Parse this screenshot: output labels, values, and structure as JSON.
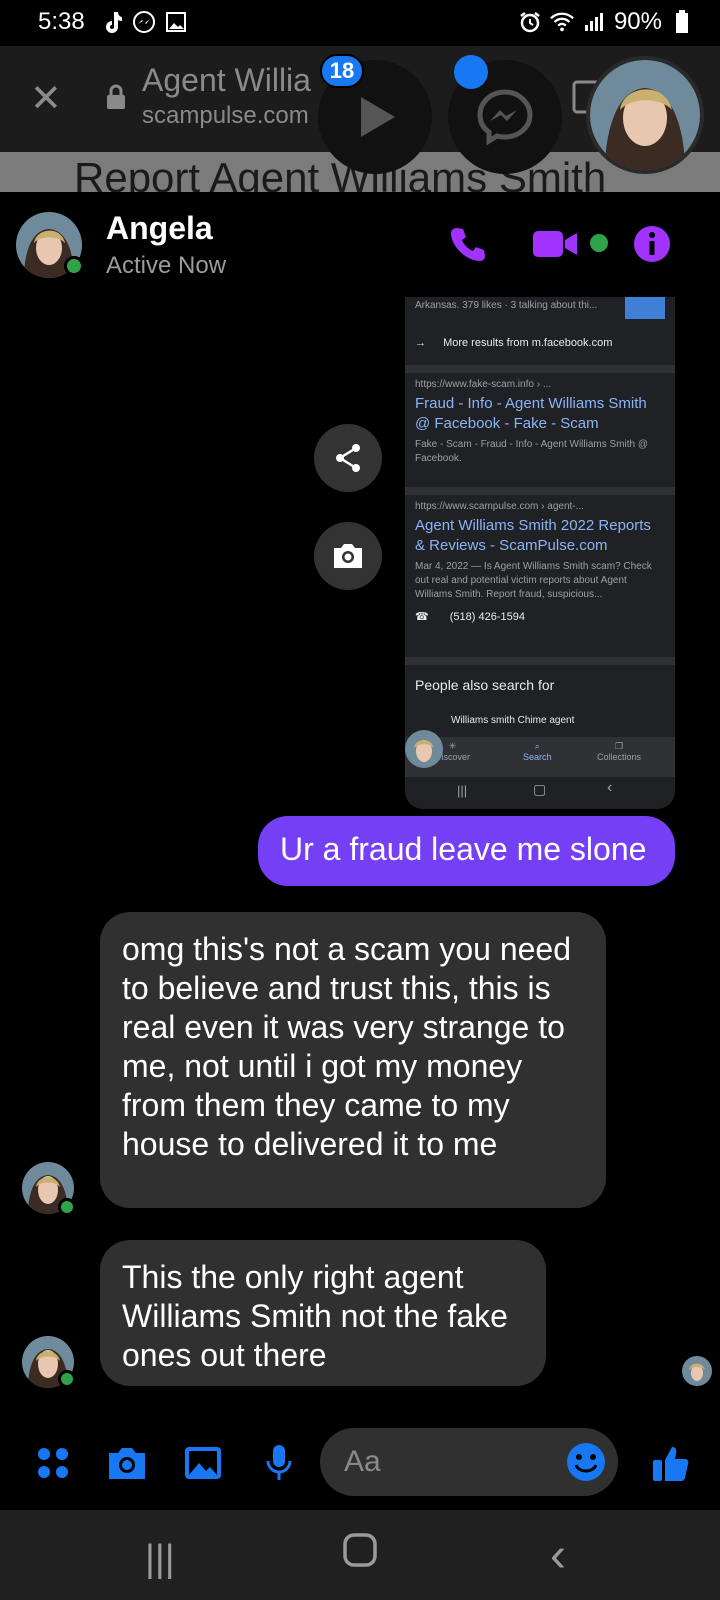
{
  "status_bar": {
    "time": "5:38",
    "battery": "90%"
  },
  "browser": {
    "title": "Agent Willia",
    "url": "scampulse.com",
    "page_heading": "Report Agent Williams Smith"
  },
  "chat_heads": {
    "unread_count": "18"
  },
  "header": {
    "name": "Angela",
    "status": "Active Now"
  },
  "shared_image": {
    "snippet_top": "Arkansas. 379 likes · 3 talking about thi...",
    "more_results": "More results from m.facebook.com",
    "result1_url": "https://www.fake-scam.info › ...",
    "result1_title": "Fraud - Info - Agent Williams Smith @ Facebook - Fake - Scam",
    "result1_desc": "Fake - Scam - Fraud - Info - Agent Williams Smith @ Facebook.",
    "result2_url": "https://www.scampulse.com › agent-...",
    "result2_title": "Agent Williams Smith 2022 Reports & Reviews - ScamPulse.com",
    "result2_desc": "Mar 4, 2022 — Is Agent Williams Smith scam? Check out real and potential victim reports about Agent Williams Smith. Report fraud, suspicious...",
    "phone": "(518) 426-1594",
    "people_also": "People also search for",
    "suggestion": "Williams smith Chime agent",
    "nav_discover": "Discover",
    "nav_search": "Search",
    "nav_collections": "Collections"
  },
  "messages": [
    {
      "direction": "out",
      "text": "Ur a fraud leave me slone"
    },
    {
      "direction": "in",
      "text": "omg this's not a scam you need to believe and trust this, this is real even it was very strange to me, not until i got my money from them they came to my house to delivered it to me"
    },
    {
      "direction": "in",
      "text": "This the only right agent Williams Smith not the fake ones out there"
    }
  ],
  "composer": {
    "placeholder": "Aa"
  },
  "colors": {
    "accent_purple": "#a033ff",
    "outgoing_bubble": "#7540f5",
    "incoming_bubble": "#303030",
    "messenger_blue": "#1877f2",
    "online_green": "#31a24c"
  }
}
